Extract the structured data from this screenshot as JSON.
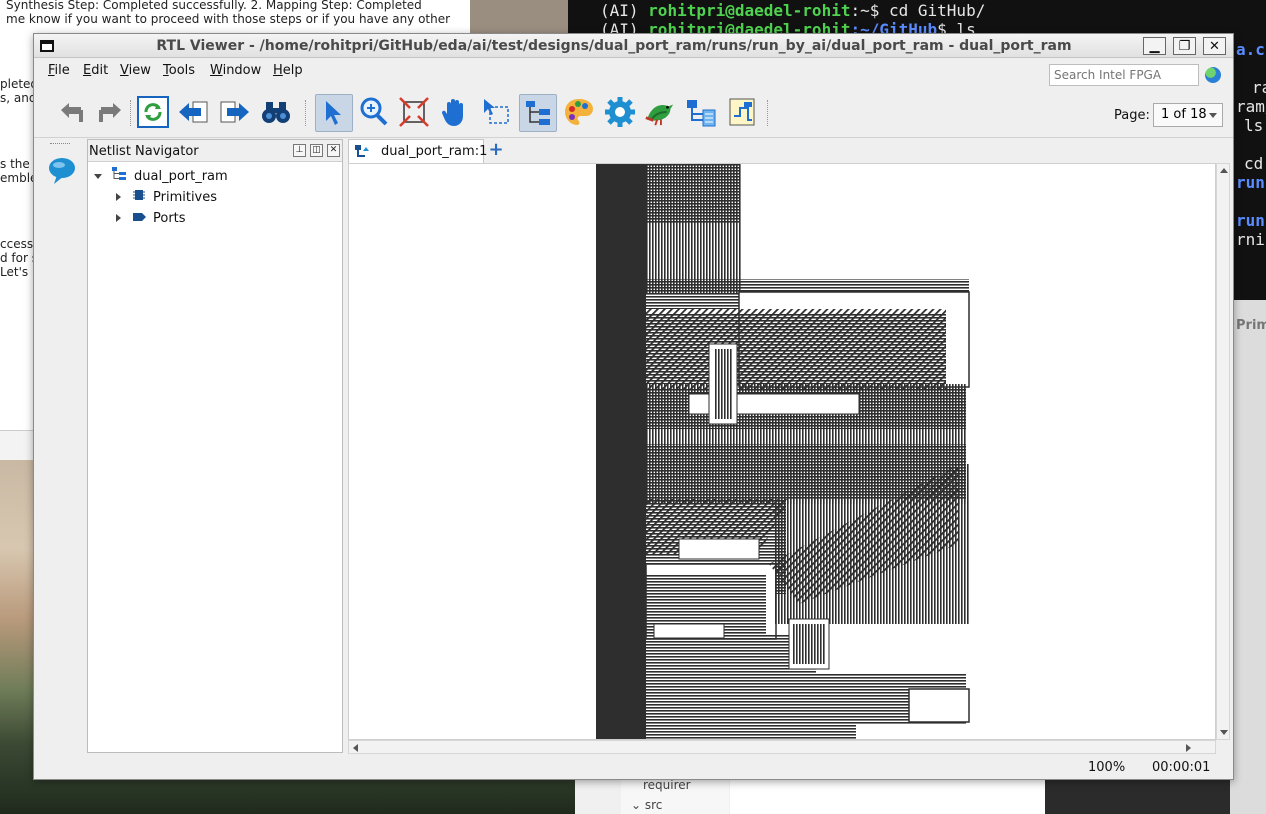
{
  "background": {
    "doc_lines": [
      "Synthesis Step: Completed successfully. 2. Mapping Step: Completed",
      "me know if you want to proceed with those steps or if you have any other",
      "pleted",
      "s, and",
      "s the s",
      "emble",
      "ccessf",
      "d for s",
      "Let's"
    ],
    "terminal_lines": [
      {
        "prefix": "(AI) ",
        "user": "rohitpri@daedel-rohit",
        "path": ":~",
        "cmd": "$ cd GitHub/"
      },
      {
        "prefix": "(AI) ",
        "user": "rohitpri@daedel-rohit",
        "path": ":~/GitHub",
        "cmd": "$ ls"
      }
    ],
    "terminal_side": [
      "a.cp",
      "ra",
      "ram/",
      "ls",
      "cd",
      "runs",
      "runs",
      "rnin"
    ],
    "vscode_panel": [
      "requirer",
      "src"
    ],
    "vscode_side": "Prim"
  },
  "window": {
    "title": "RTL Viewer - /home/rohitpri/GitHub/eda/ai/test/designs/dual_port_ram/runs/run_by_ai/dual_port_ram - dual_port_ram",
    "buttons": {
      "minimize": "▁",
      "maximize": "❐",
      "close": "✕"
    }
  },
  "menu": [
    {
      "label": "File",
      "u": "F",
      "rest": "ile"
    },
    {
      "label": "Edit",
      "u": "E",
      "rest": "dit"
    },
    {
      "label": "View",
      "u": "V",
      "rest": "iew"
    },
    {
      "label": "Tools",
      "u": "T",
      "rest": "ools"
    },
    {
      "label": "Window",
      "u": "W",
      "rest": "indow"
    },
    {
      "label": "Help",
      "u": "H",
      "rest": "elp"
    }
  ],
  "search": {
    "placeholder": "Search Intel FPGA"
  },
  "toolbar": {
    "icons": [
      "back-icon",
      "forward-icon",
      "refresh-icon",
      "go-back-icon",
      "go-forward-icon",
      "find-icon",
      "select-icon",
      "zoom-icon",
      "fit-icon",
      "hand-icon",
      "rect-select-icon",
      "hierarchy-icon",
      "palette-icon",
      "settings-icon",
      "bird-icon",
      "netlist-icon",
      "export-icon"
    ],
    "page_label": "Page:",
    "page_value": "1 of 18"
  },
  "navigator": {
    "title": "Netlist Navigator",
    "root": "dual_port_ram",
    "children": [
      "Primitives",
      "Ports"
    ]
  },
  "tabs": [
    {
      "label": "dual_port_ram:1"
    }
  ],
  "add_tab": "+",
  "status": {
    "zoom": "100%",
    "time": "00:00:01"
  },
  "colors": {
    "accent": "#1565c0",
    "schematic": "#2e2e2e",
    "active_tool": "#c9d6e6"
  }
}
